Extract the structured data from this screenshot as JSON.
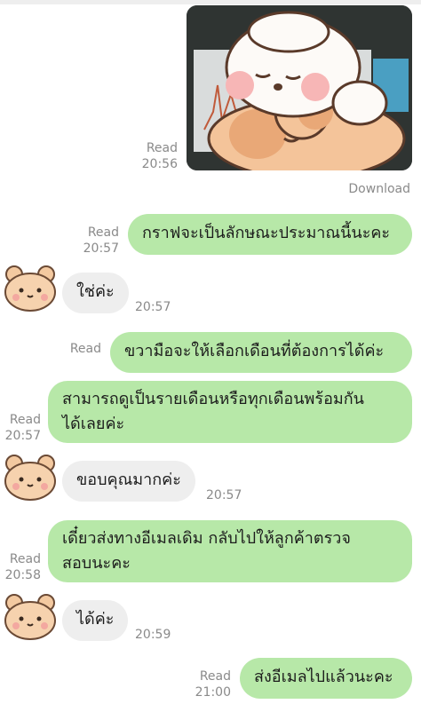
{
  "colors": {
    "outgoing_bubble": "#b7e8a8",
    "incoming_bubble": "#eeeeee",
    "meta_text": "#8a8a8a"
  },
  "image_message": {
    "status": "Read",
    "time": "20:56",
    "download_label": "Download",
    "sticker": "bunny-and-bear-sleeping-sticker"
  },
  "messages": [
    {
      "direction": "out",
      "text": "กราฟจะเป็นลักษณะประมาณนี้นะคะ",
      "status": "Read",
      "time": "20:57"
    },
    {
      "direction": "in",
      "text": "ใช่ค่ะ",
      "time": "20:57",
      "avatar": "bear-avatar-icon"
    },
    {
      "direction": "out",
      "text": "ขวามือจะให้เลือกเดือนที่ต้องการได้ค่ะ",
      "status": "Read",
      "time": ""
    },
    {
      "direction": "out",
      "text_lines": [
        "สามารถดูเป็นรายเดือนหรือทุกเดือนพร้อมกัน",
        "ได้เลยค่ะ"
      ],
      "status": "Read",
      "time": "20:57"
    },
    {
      "direction": "in",
      "text": "ขอบคุณมากค่ะ",
      "time": "20:57",
      "avatar": "bear-avatar-icon"
    },
    {
      "direction": "out",
      "text_lines": [
        "เดี๋ยวส่งทางอีเมลเดิม กลับไปให้ลูกค้าตรวจ",
        "สอบนะคะ"
      ],
      "status": "Read",
      "time": "20:58"
    },
    {
      "direction": "in",
      "text": "ได้ค่ะ",
      "time": "20:59",
      "avatar": "bear-avatar-icon"
    },
    {
      "direction": "out",
      "text": "ส่งอีเมลไปแล้วนะคะ",
      "status": "Read",
      "time": "21:00"
    }
  ]
}
